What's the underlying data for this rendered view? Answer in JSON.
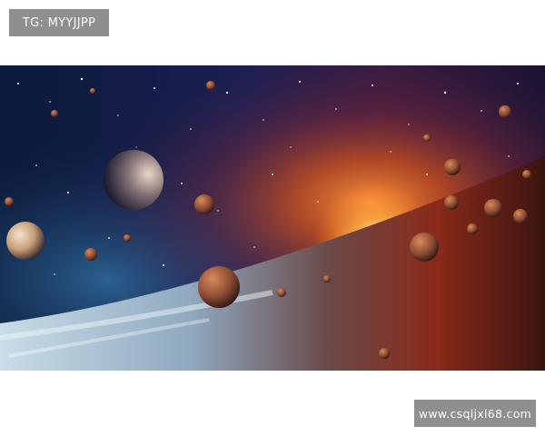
{
  "watermarks": {
    "top_label": "TG: MYYJJPP",
    "bottom_label": "www.csqljxl68.com"
  },
  "image": {
    "subject": "space-scene",
    "colors": {
      "deep_space": "#0a1430",
      "nebula_orange": "#d9561c",
      "sun_core": "#fff3c4",
      "ice_surface": "#d8e6ee",
      "planet_tan": "#c8a07a"
    }
  }
}
